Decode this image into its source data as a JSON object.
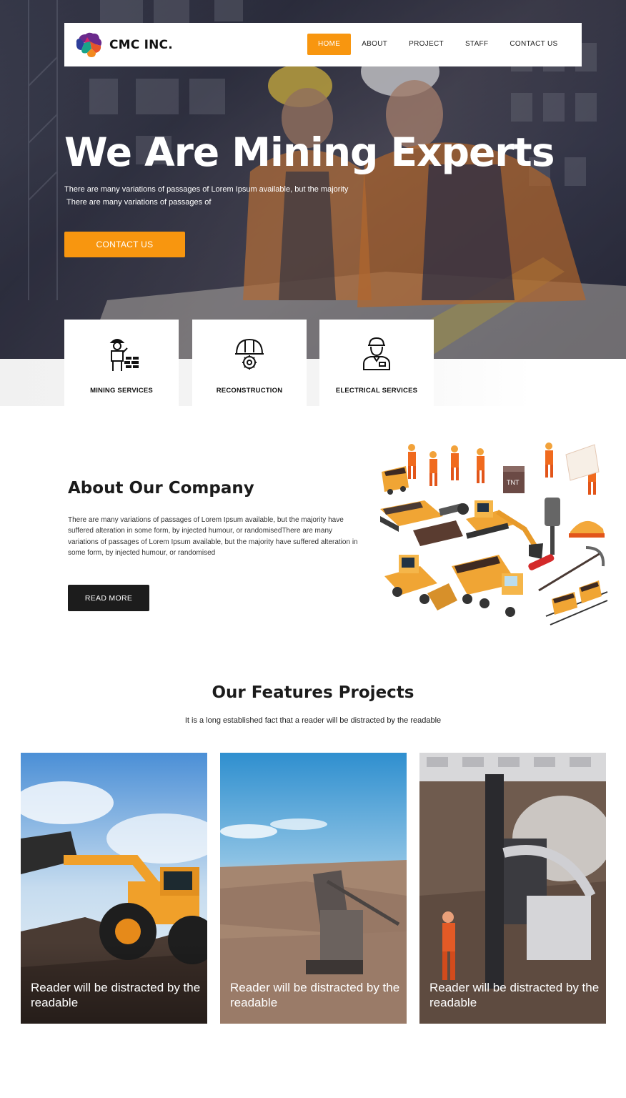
{
  "brand": {
    "name": "CMC INC."
  },
  "nav": {
    "items": [
      {
        "label": "HOME",
        "active": true
      },
      {
        "label": "ABOUT",
        "active": false
      },
      {
        "label": "PROJECT",
        "active": false
      },
      {
        "label": "STAFF",
        "active": false
      },
      {
        "label": "CONTACT US",
        "active": false
      }
    ]
  },
  "hero": {
    "title": "We Are Mining Experts",
    "subtitle_line1": "There are many variations of passages of Lorem Ipsum available, but the majority",
    "subtitle_line2": "There are many variations of passages of",
    "cta_label": "CONTACT US"
  },
  "services": [
    {
      "label": "MINING  SERVICES",
      "icon": "worker-brick-icon"
    },
    {
      "label": "RECONSTRUCTION",
      "icon": "helmet-gear-icon"
    },
    {
      "label": "ELECTRICAL SERVICES",
      "icon": "engineer-icon"
    }
  ],
  "about": {
    "title": "About Our Company",
    "text": "There are many variations of passages of Lorem Ipsum available, but the majority have suffered alteration in some form, by injected humour, or randomisedThere are many variations of passages of Lorem Ipsum available, but the majority have suffered alteration in some form, by injected humour, or randomised",
    "button_label": "READ MORE"
  },
  "projects": {
    "title": "Our Features Projects",
    "subtitle": "It is a long established fact that a reader will be distracted by the readable",
    "cards": [
      {
        "caption": "Reader will be distracted by the readable"
      },
      {
        "caption": "Reader will be distracted by the readable"
      },
      {
        "caption": "Reader will be distracted by the readable"
      }
    ]
  },
  "colors": {
    "accent": "#f8960f",
    "dark_button": "#1c1c1c",
    "text": "#1b1b1b"
  }
}
